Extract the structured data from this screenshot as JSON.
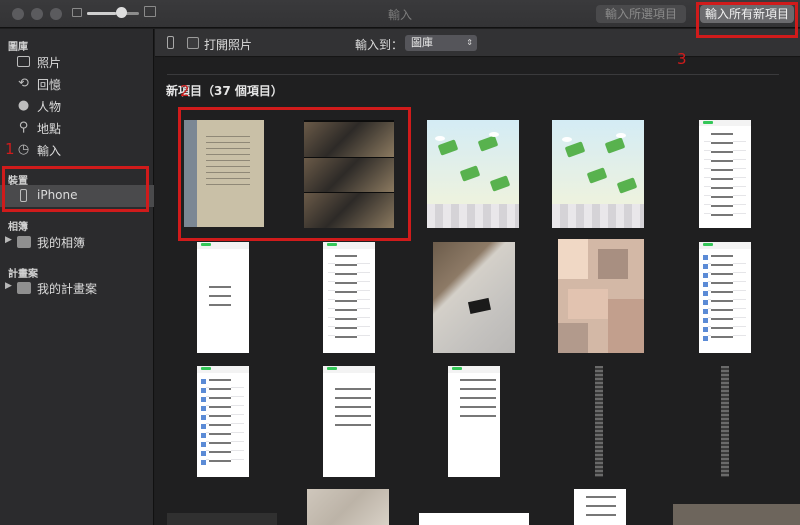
{
  "window": {
    "title": "輸入",
    "import_selected_label": "輸入所選項目",
    "import_all_label": "輸入所有新項目"
  },
  "sidebar": {
    "library_header": "圖庫",
    "library_items": [
      {
        "label": "照片",
        "icon": "photos-icon"
      },
      {
        "label": "回憶",
        "icon": "memories-icon"
      },
      {
        "label": "人物",
        "icon": "people-icon"
      },
      {
        "label": "地點",
        "icon": "places-icon"
      },
      {
        "label": "輸入",
        "icon": "import-clock-icon"
      }
    ],
    "devices_header": "裝置",
    "device_label": "iPhone",
    "albums_header": "相簿",
    "my_albums_label": "我的相簿",
    "projects_header": "計畫案",
    "my_projects_label": "我的計畫案"
  },
  "toolbar": {
    "open_photos_label": "打開照片",
    "open_photos_checked": false,
    "import_to_label": "輸入到：",
    "destination_value": "圖庫"
  },
  "content": {
    "section_title": "新項目（37 個項目）",
    "thumbnail_count": 37
  },
  "annotations": {
    "marker_1": "1",
    "marker_2": "2",
    "marker_3": "3",
    "color": "#d01b1b"
  }
}
